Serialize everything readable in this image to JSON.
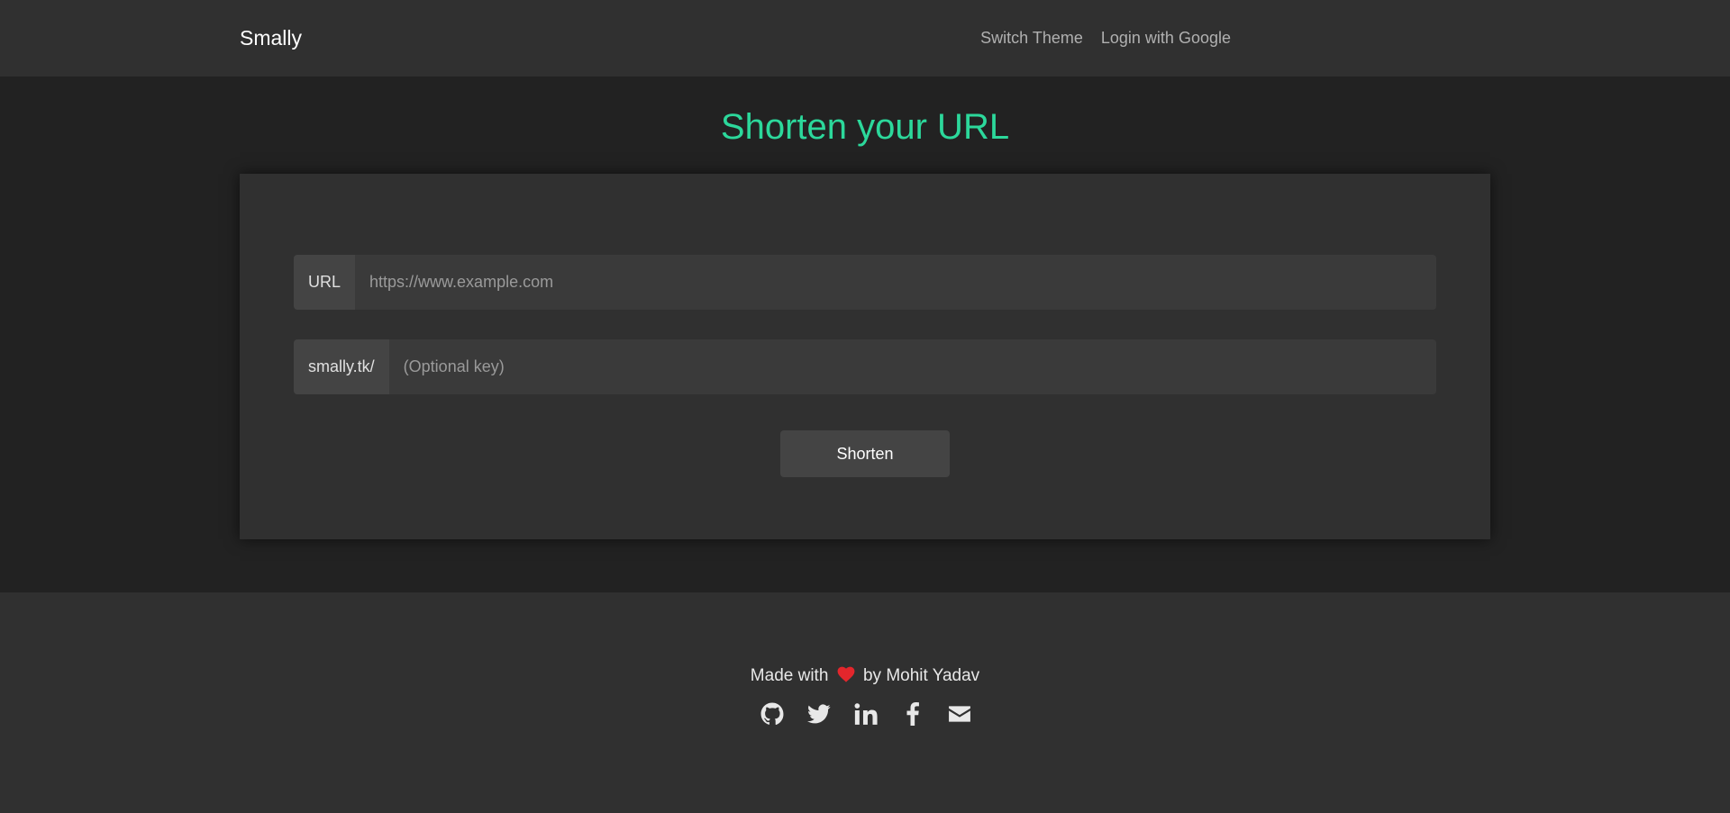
{
  "navbar": {
    "brand": "Smally",
    "links": [
      "Switch Theme",
      "Login with Google"
    ]
  },
  "main": {
    "title": "Shorten your URL",
    "url_prefix": "URL",
    "url_placeholder": "https://www.example.com",
    "url_value": "",
    "key_prefix": "smally.tk/",
    "key_placeholder": "(Optional key)",
    "key_value": "",
    "button_label": "Shorten"
  },
  "footer": {
    "made_with": "Made with",
    "by": "by Mohit Yadav",
    "socials": [
      "github-icon",
      "twitter-icon",
      "linkedin-icon",
      "facebook-icon",
      "email-icon"
    ]
  },
  "colors": {
    "accent": "#2cd89b",
    "heart": "#e3262c",
    "background": "#222222",
    "surface": "#303030"
  }
}
